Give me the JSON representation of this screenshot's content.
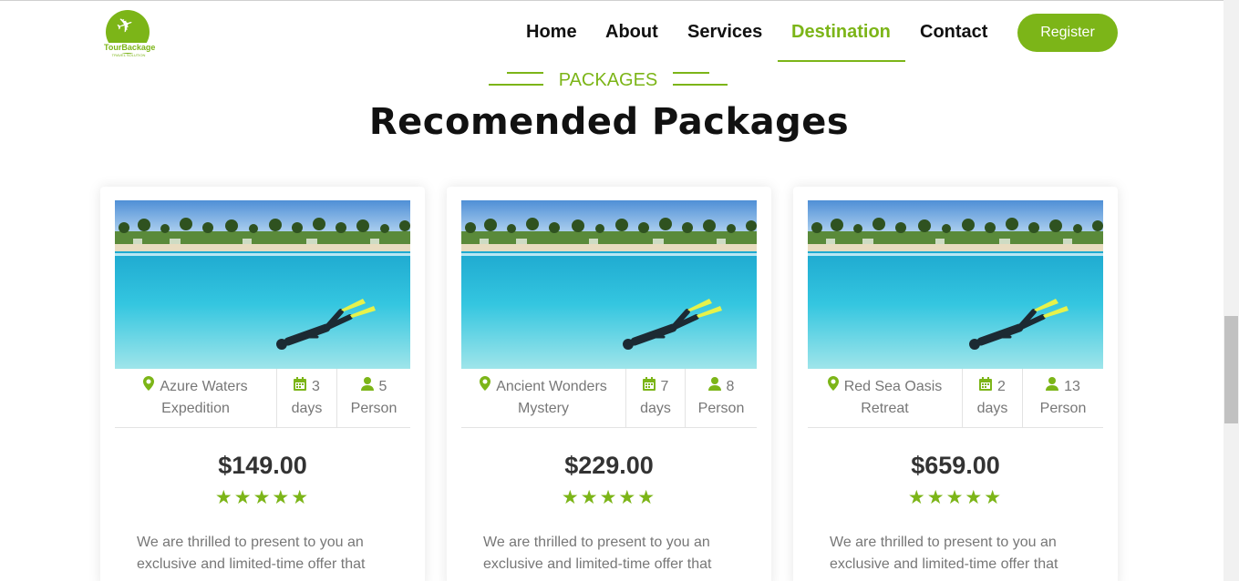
{
  "brand": {
    "logo_text": "TourBackage",
    "logo_sub": "TRAVEL SOLUTION"
  },
  "nav": {
    "items": [
      {
        "label": "Home",
        "active": false
      },
      {
        "label": "About",
        "active": false
      },
      {
        "label": "Services",
        "active": false
      },
      {
        "label": "Destination",
        "active": true
      },
      {
        "label": "Contact",
        "active": false
      }
    ],
    "register_label": "Register"
  },
  "section": {
    "label": "PACKAGES",
    "title": "Recomended Packages"
  },
  "packages": [
    {
      "name_line1": "Azure Waters",
      "name_line2": "Expedition",
      "days": "3",
      "days_label": "days",
      "persons": "5",
      "persons_label": "Person",
      "price": "$149.00",
      "rating": 5,
      "description": "We are thrilled to present to you an exclusive and limited-time offer that"
    },
    {
      "name_line1": "Ancient Wonders",
      "name_line2": "Mystery",
      "days": "7",
      "days_label": "days",
      "persons": "8",
      "persons_label": "Person",
      "price": "$229.00",
      "rating": 5,
      "description": "We are thrilled to present to you an exclusive and limited-time offer that"
    },
    {
      "name_line1": "Red Sea Oasis",
      "name_line2": "Retreat",
      "days": "2",
      "days_label": "days",
      "persons": "13",
      "persons_label": "Person",
      "price": "$659.00",
      "rating": 5,
      "description": "We are thrilled to present to you an exclusive and limited-time offer that"
    }
  ],
  "colors": {
    "accent": "#7cb518",
    "text_dark": "#111111",
    "text_muted": "#777777"
  },
  "icons": {
    "location": "map-pin-icon",
    "calendar": "calendar-icon",
    "person": "user-icon",
    "star": "star-icon",
    "logo": "airplane-icon"
  }
}
